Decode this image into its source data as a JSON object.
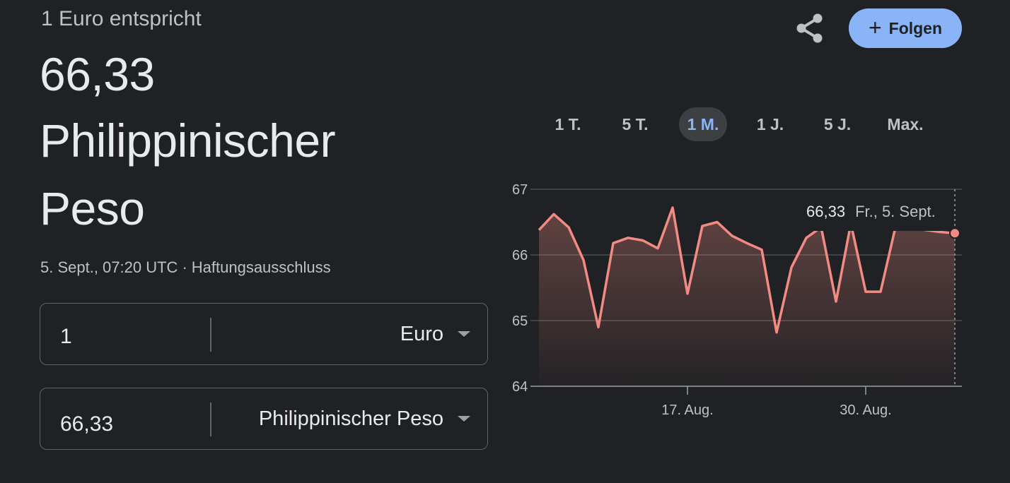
{
  "header": {
    "label": "1 Euro entspricht"
  },
  "rate": {
    "value": "66,33",
    "currency_line1": "Philippinischer",
    "currency_line2": "Peso"
  },
  "meta": {
    "timestamp": "5. Sept., 07:20 UTC",
    "separator": "·",
    "disclaimer": "Haftungsausschluss"
  },
  "converter": {
    "from": {
      "amount": "1",
      "currency": "Euro"
    },
    "to": {
      "amount": "66,33",
      "currency": "Philippinischer Peso"
    }
  },
  "actions": {
    "share_icon": "share-icon",
    "follow_label": "Folgen",
    "follow_icon": "+"
  },
  "ranges": [
    {
      "label": "1 T.",
      "active": false
    },
    {
      "label": "5 T.",
      "active": false
    },
    {
      "label": "1 M.",
      "active": true
    },
    {
      "label": "1 J.",
      "active": false
    },
    {
      "label": "5 J.",
      "active": false
    },
    {
      "label": "Max.",
      "active": false
    }
  ],
  "tooltip": {
    "value": "66,33",
    "date": "Fr., 5. Sept."
  },
  "colors": {
    "background": "#202124",
    "line": "#f28b82",
    "accent": "#8ab4f8",
    "grid": "#5f6368"
  },
  "chart_data": {
    "type": "area",
    "y_ticks": [
      "67",
      "66",
      "65",
      "64"
    ],
    "ylim": [
      64,
      67
    ],
    "x_ticks": [
      "17. Aug.",
      "30. Aug."
    ],
    "values": [
      66.38,
      66.62,
      66.42,
      65.92,
      64.9,
      66.18,
      66.26,
      66.22,
      66.1,
      66.72,
      65.41,
      66.44,
      66.5,
      66.29,
      66.18,
      66.08,
      64.82,
      65.81,
      66.26,
      66.42,
      65.29,
      66.48,
      65.44,
      65.44,
      66.42,
      66.44,
      66.38,
      66.35,
      66.33
    ],
    "grid": true
  }
}
